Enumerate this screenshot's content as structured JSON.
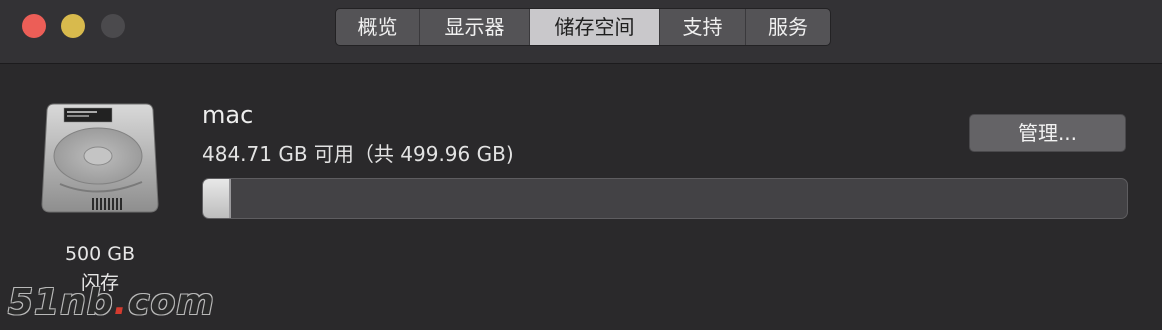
{
  "window": {
    "controls": [
      "close",
      "minimize",
      "zoom"
    ]
  },
  "tabs": [
    {
      "label": "概览",
      "active": false
    },
    {
      "label": "显示器",
      "active": false
    },
    {
      "label": "储存空间",
      "active": true
    },
    {
      "label": "支持",
      "active": false
    },
    {
      "label": "服务",
      "active": false
    }
  ],
  "disk": {
    "icon": "hard-drive-icon",
    "size_label": "500 GB",
    "type_label": "闪存"
  },
  "volume": {
    "name": "mac",
    "available_text": "484.71 GB 可用（共 499.96 GB)",
    "used_fraction": 0.03
  },
  "manage_button": {
    "label": "管理..."
  },
  "watermark": {
    "text_prefix": "51nb",
    "dot": ".",
    "text_suffix": "com"
  },
  "colors": {
    "background": "#2a292b",
    "tab_active": "#c9c8cb",
    "close": "#ec5e57",
    "minimize": "#d8ba4d",
    "zoom": "#4b4a4d"
  }
}
